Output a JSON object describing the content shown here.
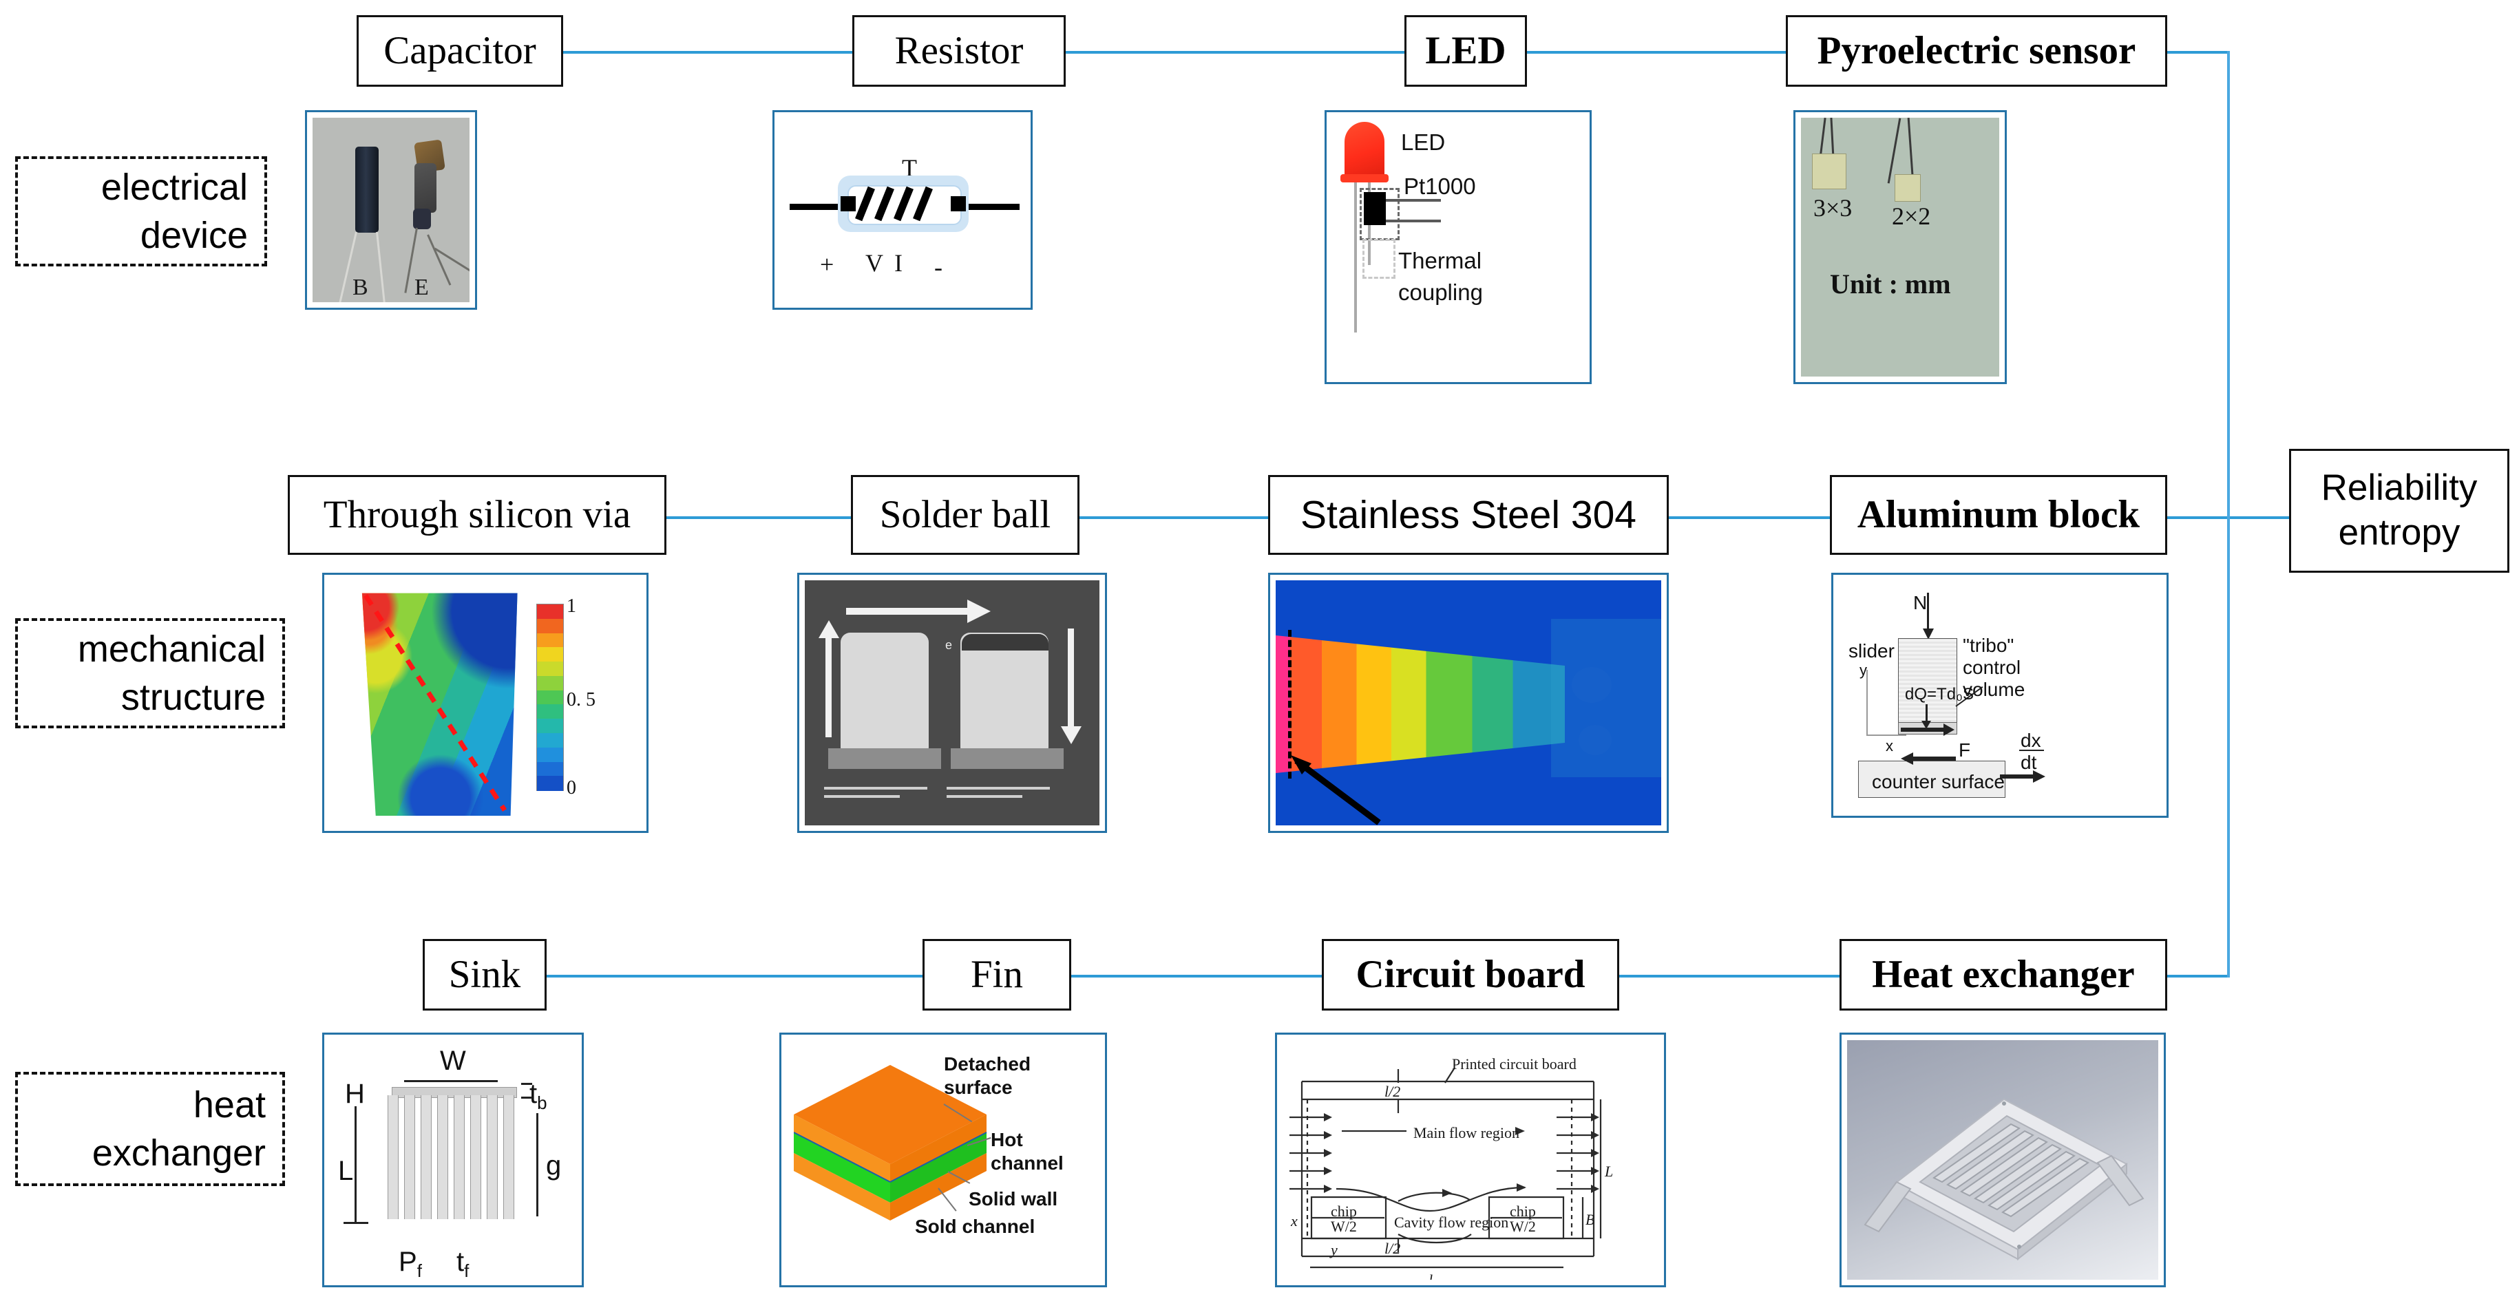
{
  "diagram": {
    "title": "Reliability entropy research objects",
    "accent_line_color": "#2e9bd6",
    "node_border_color": "#111111",
    "panel_border_color": "#2573a7"
  },
  "hub": {
    "label": "Reliability\nentropy",
    "line1": "Reliability",
    "line2": "entropy"
  },
  "categories": [
    {
      "id": "electrical-device",
      "line1": "electrical",
      "line2": "device"
    },
    {
      "id": "mechanical-structure",
      "line1": "mechanical",
      "line2": "structure"
    },
    {
      "id": "heat-exchanger",
      "line1": "heat",
      "line2": "exchanger"
    }
  ],
  "rows": [
    {
      "id": "electrical-device",
      "nodes": [
        {
          "id": "capacitor",
          "label": "Capacitor",
          "style": "serif"
        },
        {
          "id": "resistor",
          "label": "Resistor",
          "style": "serif"
        },
        {
          "id": "led",
          "label": "LED",
          "style": "serif-b"
        },
        {
          "id": "pyroelectric-sensor",
          "label": "Pyroelectric sensor",
          "style": "serif-b"
        }
      ]
    },
    {
      "id": "mechanical-structure",
      "nodes": [
        {
          "id": "through-silicon-via",
          "label": "Through silicon via",
          "style": "serif"
        },
        {
          "id": "solder-ball",
          "label": "Solder ball",
          "style": "serif"
        },
        {
          "id": "stainless-steel-304",
          "label": "Stainless Steel 304",
          "style": "sans"
        },
        {
          "id": "aluminum-block",
          "label": "Aluminum block",
          "style": "serif-b"
        }
      ]
    },
    {
      "id": "heat-exchanger",
      "nodes": [
        {
          "id": "sink",
          "label": "Sink",
          "style": "serif"
        },
        {
          "id": "fin",
          "label": "Fin",
          "style": "serif"
        },
        {
          "id": "circuit-board",
          "label": "Circuit board",
          "style": "serif-b"
        },
        {
          "id": "heat-exchanger-node",
          "label": "Heat exchanger",
          "style": "serif-b"
        }
      ]
    }
  ],
  "figures": {
    "capacitor_photo": {
      "label_left": "B",
      "label_right": "E"
    },
    "resistor_schematic": {
      "top_label": "T",
      "plus": "+",
      "voltage": "V",
      "current": "I",
      "minus": "-"
    },
    "led_schematic": {
      "led_label": "LED",
      "sensor_label": "Pt1000",
      "coupling_line1": "Thermal",
      "coupling_line2": "coupling"
    },
    "pyro_photo": {
      "size_left": "3×3",
      "size_right": "2×2",
      "unit": "Unit : mm"
    },
    "tsv_contour": {
      "scale_max": "1",
      "scale_mid": "0. 5",
      "scale_min": "0"
    },
    "solder_ball_sem": {
      "annotation": "e"
    },
    "tribo_diagram": {
      "normal_load": "N",
      "slider": "slider",
      "tribo_l1": "\"tribo\"",
      "tribo_l2": "control",
      "tribo_l3": "volume",
      "heat": "dQ=Td₀S",
      "axis_y": "y",
      "axis_x": "x",
      "friction": "F",
      "velocity_num": "dx",
      "velocity_den": "dt",
      "counter_surface": "counter surface"
    },
    "heat_sink": {
      "width": "W",
      "height": "H",
      "length": "L",
      "base_thickness": "t",
      "base_sub": "b",
      "gravity": "g",
      "fin_pitch": "P",
      "fin_pitch_sub": "f",
      "fin_thickness": "t",
      "fin_thickness_sub": "f"
    },
    "fin_slab": {
      "detached_l1": "Detached",
      "detached_l2": "surface",
      "hot_l1": "Hot",
      "hot_l2": "channel",
      "solid_wall": "Solid wall",
      "sold_channel": "Sold channel"
    },
    "circuit_board": {
      "pcb": "Printed circuit board",
      "main_flow": "Main flow region",
      "cavity_flow": "Cavity flow region",
      "chip_left_l1": "chip",
      "chip_left_l2": "W/2",
      "chip_right_l1": "chip",
      "chip_right_l2": "W/2",
      "b_label": "B",
      "l_label": "L",
      "ls_label": "l",
      "ls_sub": "s",
      "x_axis": "x",
      "y_axis": "y",
      "gap_top": "l/2",
      "gap_bottom": "l/2"
    }
  }
}
